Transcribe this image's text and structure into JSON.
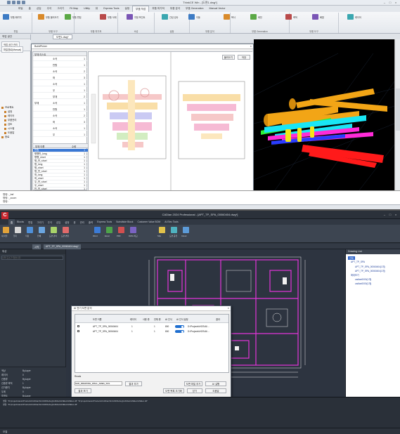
{
  "top_app": {
    "title": "ThinkCE Win - [도면1.dwg*]",
    "ribbon_tabs": [
      "파일",
      "홈",
      "삽입",
      "주석",
      "그리기",
      "Fit Map",
      "Utility",
      "뷰",
      "Express Tools",
      "설정",
      "부품 작성",
      "부품 피가져",
      "부품 분석",
      "부품 Generation",
      "Manual Vector"
    ],
    "active_tab_index": 10,
    "ribbon_groups": [
      "편집",
      "부품 도구",
      "부품 피가져",
      "속성",
      "설정",
      "부품 분석",
      "부품 Generation",
      "부품 도구"
    ],
    "ribbon_items": [
      "부품 패키지",
      "부품 불러오기",
      "부품 편집",
      "부품 삭제",
      "지정 포인트",
      "간섭 검사",
      "이동",
      "복사",
      "회전",
      "축척",
      "배열",
      "레이어"
    ],
    "doc_tab": "도면1.dwg*",
    "left_pane": {
      "header": "작업 공간",
      "tabs": [
        "작업 공간 관리",
        "파일경로(Manual)"
      ],
      "tree": [
        "프로젝트",
        "설정",
        "레이어",
        "부품관리",
        "검토",
        "시스템",
        "도움말",
        "종료"
      ]
    },
    "dialog": {
      "title": "BuildPicker",
      "side_header": "부재 리스트",
      "side_rows": [
        {
          "k": "",
          "v": "소곡",
          "n": "1"
        },
        {
          "k": "",
          "v": "반원",
          "n": "1"
        },
        {
          "k": "",
          "v": "소곡",
          "n": "2"
        },
        {
          "k": "",
          "v": "좌",
          "n": "3"
        },
        {
          "k": "",
          "v": "소곡",
          "n": "1"
        },
        {
          "k": "",
          "v": "우",
          "n": "1"
        },
        {
          "k": "",
          "v": "부재",
          "n": "2"
        },
        {
          "k": "부재",
          "v": "소곡",
          "n": "1"
        },
        {
          "k": "",
          "v": "반원",
          "n": "1"
        },
        {
          "k": "",
          "v": "소곡",
          "n": "2"
        },
        {
          "k": "",
          "v": "좌",
          "n": "3"
        },
        {
          "k": "",
          "v": "소곡",
          "n": "1"
        },
        {
          "k": "",
          "v": "우",
          "n": "1"
        }
      ],
      "list_header": [
        "부재 이름",
        "수량"
      ],
      "list_rows": [
        {
          "name": "반원",
          "qty": "1"
        },
        {
          "name": "평행반_long",
          "qty": "1"
        },
        {
          "name": "평행_short",
          "qty": "1"
        },
        {
          "name": "평_반_short",
          "qty": "1"
        },
        {
          "name": "평_long",
          "qty": "1"
        },
        {
          "name": "평_short",
          "qty": "1"
        },
        {
          "name": "평_반_short",
          "qty": "1"
        },
        {
          "name": "좌_long",
          "qty": "1"
        },
        {
          "name": "좌_short",
          "qty": "1"
        },
        {
          "name": "우_반_short",
          "qty": "1"
        },
        {
          "name": "우_short",
          "qty": "1"
        },
        {
          "name": "반_반_short",
          "qty": "1"
        }
      ],
      "buttons": [
        "불러오기",
        "저장"
      ]
    },
    "command_lines": [
      "명령: _bsf",
      "명령: _zoom",
      "명령:"
    ],
    "viewport_colors": {
      "bg": "#000000",
      "ramp": "#f2a516",
      "red": "#ff1a1a",
      "cyan": "#19e6f5",
      "magenta": "#ff2bd8",
      "green": "#2cf23a",
      "yellow": "#f5e616",
      "blue": "#2a3dff"
    }
  },
  "bottom_app": {
    "title": "CADian 2024 Professional - [APT_TP_SPA_00060404.dwg*]",
    "ribbon_tabs": [
      "홈",
      "Blocks",
      "편집",
      "그리기",
      "주석",
      "삽입",
      "설정",
      "뷰",
      "관리",
      "출력",
      "Express Tools",
      "Substitute Block",
      "Customer Value BOM",
      "AI Elec Tools"
    ],
    "active_tab_index": 0,
    "ribbon_labels": [
      "새 파일",
      "열기",
      "저장",
      "인쇄",
      "도면 관리",
      "도면 변환",
      "Word",
      "Excel",
      "PDF",
      "DWG 비교",
      "Shp",
      "도면 공유",
      "Cloud"
    ],
    "doc_tabs": [
      "시작",
      "APT_TP_SPA_00060404.dwg*"
    ],
    "left_header": "특성",
    "left_search_placeholder": "선택 요소가 없습니다",
    "props": [
      {
        "k": "색상",
        "v": "ByLayer"
      },
      {
        "k": "레이어",
        "v": "0"
      },
      {
        "k": "선종류",
        "v": "ByLayer"
      },
      {
        "k": "선종류 축척",
        "v": "1"
      },
      {
        "k": "선가중치",
        "v": "ByLayer"
      },
      {
        "k": "두께",
        "v": "0"
      },
      {
        "k": "투명도",
        "v": "ByLayer"
      }
    ],
    "dialog": {
      "title": "AI 전기 도면 분석",
      "columns": [
        "",
        "도면 이름",
        "레이어",
        "사용 층",
        "전체 층",
        "AI 인식",
        "AI 인식 설정",
        "결과"
      ],
      "rows": [
        {
          "name": "APT_TP_SPA_00060404",
          "a": "1",
          "b": "1",
          "c": "800",
          "path": "D:\\Projects\\HOS\\AI\\..."
        },
        {
          "name": "APT_TP_SPA_00060404",
          "a": "1",
          "b": "1",
          "c": "800",
          "path": "D:\\Projects\\HOS\\AI\\..."
        }
      ],
      "footer_label": "Reads",
      "footer_input": "SAD_DRAWING_WALL_AREA_SOL",
      "footer_buttons": [
        "결과 추가",
        "도면 파일 추가",
        "결과 보기",
        "AI 실행",
        "도면 목록 초기화",
        "닫기",
        "도움말"
      ]
    },
    "right_header": "Drawing List",
    "right_tree": [
      "전체",
      "APT_TP_SPA",
      "APT_TP_SPA_00060404(1개)",
      "APT_TP_SPA_00060404(1개)",
      "확대보기",
      "cadian0000(1개)",
      "cadian0000(1개)"
    ],
    "cmd_lines": [
      "명령: \"D:\\projects\\auto\\Products\\CADian\\bin\\x64\\Debug\\CADian\\AI\\Elec\\AI\\Elec.dll\" \"D:\\projects\\auto\\Products\\CADian\\bin\\x64\\Debug\\CADian\\AI\\Elec\\AI\\Elec.dll\"",
      "명령: \"D:\\projects\\auto\\Products\\CADian\\bin\\x64\\Debug\\CADian\\AI\\Elec\\AI\\Elec.dll\""
    ],
    "status_text": "모델",
    "colors": {
      "bg": "#2c333d",
      "wall": "#e335d9",
      "white": "#e6e6e6",
      "dim": "#f2f2f2"
    }
  }
}
